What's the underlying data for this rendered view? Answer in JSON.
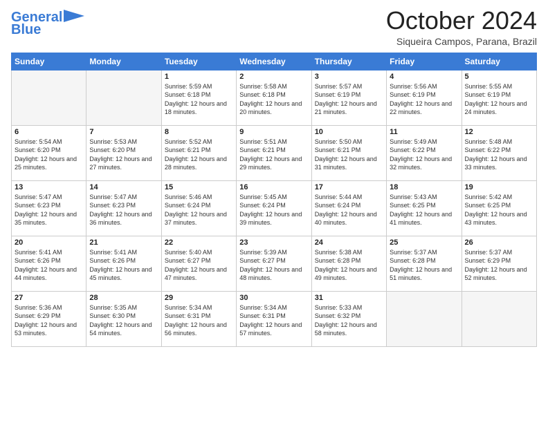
{
  "header": {
    "logo_line1": "General",
    "logo_line2": "Blue",
    "month": "October 2024",
    "location": "Siqueira Campos, Parana, Brazil"
  },
  "days_of_week": [
    "Sunday",
    "Monday",
    "Tuesday",
    "Wednesday",
    "Thursday",
    "Friday",
    "Saturday"
  ],
  "weeks": [
    [
      {
        "day": "",
        "info": "",
        "empty": true
      },
      {
        "day": "",
        "info": "",
        "empty": true
      },
      {
        "day": "1",
        "info": "Sunrise: 5:59 AM\nSunset: 6:18 PM\nDaylight: 12 hours and 18 minutes.",
        "empty": false
      },
      {
        "day": "2",
        "info": "Sunrise: 5:58 AM\nSunset: 6:18 PM\nDaylight: 12 hours and 20 minutes.",
        "empty": false
      },
      {
        "day": "3",
        "info": "Sunrise: 5:57 AM\nSunset: 6:19 PM\nDaylight: 12 hours and 21 minutes.",
        "empty": false
      },
      {
        "day": "4",
        "info": "Sunrise: 5:56 AM\nSunset: 6:19 PM\nDaylight: 12 hours and 22 minutes.",
        "empty": false
      },
      {
        "day": "5",
        "info": "Sunrise: 5:55 AM\nSunset: 6:19 PM\nDaylight: 12 hours and 24 minutes.",
        "empty": false
      }
    ],
    [
      {
        "day": "6",
        "info": "Sunrise: 5:54 AM\nSunset: 6:20 PM\nDaylight: 12 hours and 25 minutes.",
        "empty": false
      },
      {
        "day": "7",
        "info": "Sunrise: 5:53 AM\nSunset: 6:20 PM\nDaylight: 12 hours and 27 minutes.",
        "empty": false
      },
      {
        "day": "8",
        "info": "Sunrise: 5:52 AM\nSunset: 6:21 PM\nDaylight: 12 hours and 28 minutes.",
        "empty": false
      },
      {
        "day": "9",
        "info": "Sunrise: 5:51 AM\nSunset: 6:21 PM\nDaylight: 12 hours and 29 minutes.",
        "empty": false
      },
      {
        "day": "10",
        "info": "Sunrise: 5:50 AM\nSunset: 6:21 PM\nDaylight: 12 hours and 31 minutes.",
        "empty": false
      },
      {
        "day": "11",
        "info": "Sunrise: 5:49 AM\nSunset: 6:22 PM\nDaylight: 12 hours and 32 minutes.",
        "empty": false
      },
      {
        "day": "12",
        "info": "Sunrise: 5:48 AM\nSunset: 6:22 PM\nDaylight: 12 hours and 33 minutes.",
        "empty": false
      }
    ],
    [
      {
        "day": "13",
        "info": "Sunrise: 5:47 AM\nSunset: 6:23 PM\nDaylight: 12 hours and 35 minutes.",
        "empty": false
      },
      {
        "day": "14",
        "info": "Sunrise: 5:47 AM\nSunset: 6:23 PM\nDaylight: 12 hours and 36 minutes.",
        "empty": false
      },
      {
        "day": "15",
        "info": "Sunrise: 5:46 AM\nSunset: 6:24 PM\nDaylight: 12 hours and 37 minutes.",
        "empty": false
      },
      {
        "day": "16",
        "info": "Sunrise: 5:45 AM\nSunset: 6:24 PM\nDaylight: 12 hours and 39 minutes.",
        "empty": false
      },
      {
        "day": "17",
        "info": "Sunrise: 5:44 AM\nSunset: 6:24 PM\nDaylight: 12 hours and 40 minutes.",
        "empty": false
      },
      {
        "day": "18",
        "info": "Sunrise: 5:43 AM\nSunset: 6:25 PM\nDaylight: 12 hours and 41 minutes.",
        "empty": false
      },
      {
        "day": "19",
        "info": "Sunrise: 5:42 AM\nSunset: 6:25 PM\nDaylight: 12 hours and 43 minutes.",
        "empty": false
      }
    ],
    [
      {
        "day": "20",
        "info": "Sunrise: 5:41 AM\nSunset: 6:26 PM\nDaylight: 12 hours and 44 minutes.",
        "empty": false
      },
      {
        "day": "21",
        "info": "Sunrise: 5:41 AM\nSunset: 6:26 PM\nDaylight: 12 hours and 45 minutes.",
        "empty": false
      },
      {
        "day": "22",
        "info": "Sunrise: 5:40 AM\nSunset: 6:27 PM\nDaylight: 12 hours and 47 minutes.",
        "empty": false
      },
      {
        "day": "23",
        "info": "Sunrise: 5:39 AM\nSunset: 6:27 PM\nDaylight: 12 hours and 48 minutes.",
        "empty": false
      },
      {
        "day": "24",
        "info": "Sunrise: 5:38 AM\nSunset: 6:28 PM\nDaylight: 12 hours and 49 minutes.",
        "empty": false
      },
      {
        "day": "25",
        "info": "Sunrise: 5:37 AM\nSunset: 6:28 PM\nDaylight: 12 hours and 51 minutes.",
        "empty": false
      },
      {
        "day": "26",
        "info": "Sunrise: 5:37 AM\nSunset: 6:29 PM\nDaylight: 12 hours and 52 minutes.",
        "empty": false
      }
    ],
    [
      {
        "day": "27",
        "info": "Sunrise: 5:36 AM\nSunset: 6:29 PM\nDaylight: 12 hours and 53 minutes.",
        "empty": false
      },
      {
        "day": "28",
        "info": "Sunrise: 5:35 AM\nSunset: 6:30 PM\nDaylight: 12 hours and 54 minutes.",
        "empty": false
      },
      {
        "day": "29",
        "info": "Sunrise: 5:34 AM\nSunset: 6:31 PM\nDaylight: 12 hours and 56 minutes.",
        "empty": false
      },
      {
        "day": "30",
        "info": "Sunrise: 5:34 AM\nSunset: 6:31 PM\nDaylight: 12 hours and 57 minutes.",
        "empty": false
      },
      {
        "day": "31",
        "info": "Sunrise: 5:33 AM\nSunset: 6:32 PM\nDaylight: 12 hours and 58 minutes.",
        "empty": false
      },
      {
        "day": "",
        "info": "",
        "empty": true
      },
      {
        "day": "",
        "info": "",
        "empty": true
      }
    ]
  ]
}
